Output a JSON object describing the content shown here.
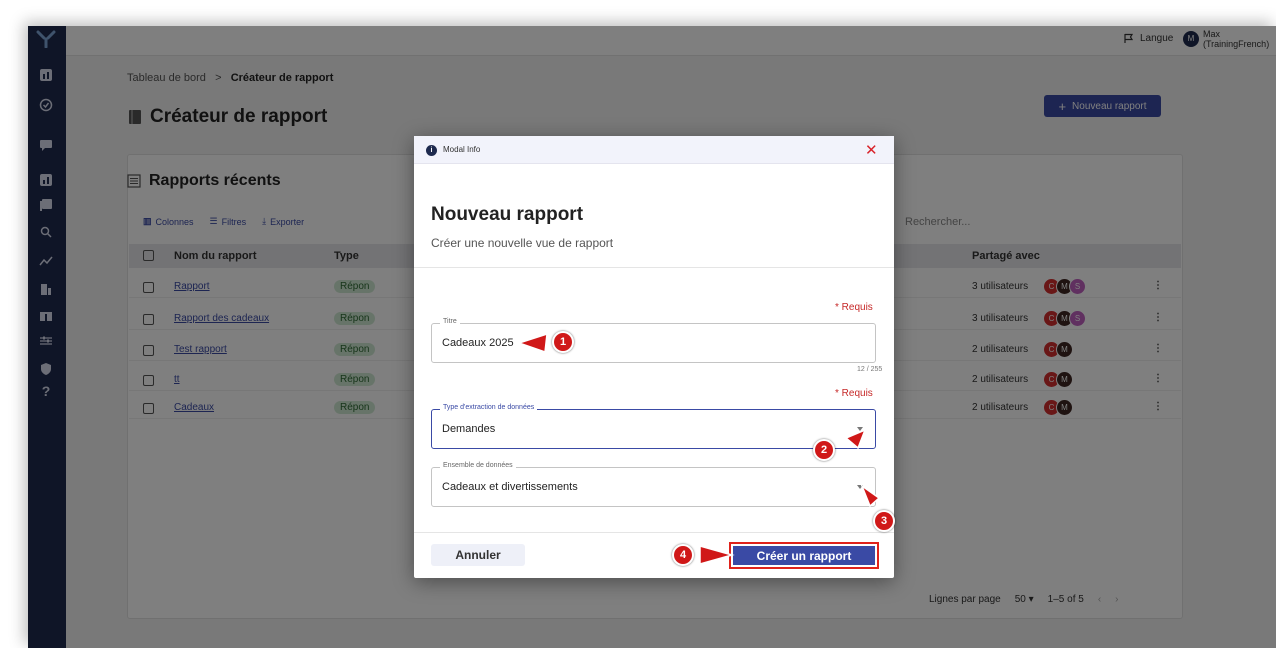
{
  "topbar": {
    "language_label": "Langue",
    "user_initial": "M",
    "user_name": "Max",
    "user_sub": "(TrainingFrench)"
  },
  "breadcrumb": {
    "root": "Tableau de bord",
    "separator": ">",
    "current": "Créateur de rapport"
  },
  "page": {
    "title": "Créateur de rapport",
    "new_button": "Nouveau rapport"
  },
  "recent": {
    "title": "Rapports récents",
    "toolbar": {
      "columns": "Colonnes",
      "filters": "Filtres",
      "export": "Exporter"
    },
    "search_placeholder": "Rechercher...",
    "headers": {
      "name": "Nom du rapport",
      "type": "Type",
      "shared": "Partagé avec"
    },
    "rows": [
      {
        "name": "Rapport",
        "type": "Répon",
        "shared": "3 utilisateurs",
        "avatars": [
          "C",
          "M",
          "S"
        ]
      },
      {
        "name": "Rapport des cadeaux",
        "type": "Répon",
        "shared": "3 utilisateurs",
        "avatars": [
          "C",
          "M",
          "S"
        ]
      },
      {
        "name": "Test rapport",
        "type": "Répon",
        "shared": "2 utilisateurs",
        "avatars": [
          "C",
          "M"
        ]
      },
      {
        "name": "tt",
        "type": "Répon",
        "shared": "2 utilisateurs",
        "avatars": [
          "C",
          "M"
        ]
      },
      {
        "name": "Cadeaux",
        "type": "Répon",
        "shared": "2 utilisateurs",
        "avatars": [
          "C",
          "M"
        ]
      }
    ],
    "footer": {
      "rows_per_page_label": "Lignes par page",
      "rows_per_page": "50",
      "range": "1–5 of 5"
    }
  },
  "modal": {
    "header_title": "Modal Info",
    "title": "Nouveau rapport",
    "subtitle": "Créer une nouvelle vue de rapport",
    "required_label": "* Requis",
    "title_field": {
      "label": "Titre",
      "value": "Cadeaux 2025",
      "counter": "12 / 255"
    },
    "extraction_field": {
      "label": "Type d'extraction de données",
      "value": "Demandes"
    },
    "dataset_field": {
      "label": "Ensemble de données",
      "value": "Cadeaux et divertissements"
    },
    "cancel_button": "Annuler",
    "create_button": "Créer un rapport"
  },
  "annotations": {
    "m1": "1",
    "m2": "2",
    "m3": "3",
    "m4": "4"
  },
  "colors": {
    "sidebar": "#1e2a4e",
    "primary": "#3a4aa5",
    "marker": "#d01818",
    "avatar_c": "#d32f2f",
    "avatar_m": "#3e2723",
    "avatar_s": "#c060c0"
  }
}
